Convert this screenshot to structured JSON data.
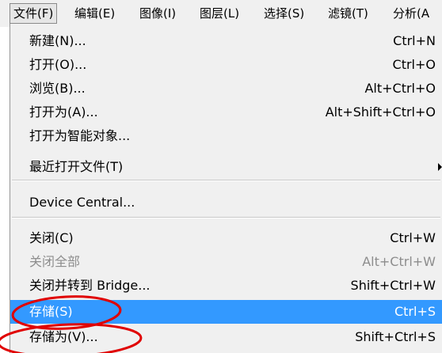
{
  "menubar": {
    "items": [
      {
        "label": "文件(F)"
      },
      {
        "label": "编辑(E)"
      },
      {
        "label": "图像(I)"
      },
      {
        "label": "图层(L)"
      },
      {
        "label": "选择(S)"
      },
      {
        "label": "滤镜(T)"
      },
      {
        "label": "分析(A"
      }
    ]
  },
  "file_menu": {
    "items": [
      {
        "label": "新建(N)...",
        "shortcut": "Ctrl+N",
        "enabled": true
      },
      {
        "label": "打开(O)...",
        "shortcut": "Ctrl+O",
        "enabled": true
      },
      {
        "label": "浏览(B)...",
        "shortcut": "Alt+Ctrl+O",
        "enabled": true
      },
      {
        "label": "打开为(A)...",
        "shortcut": "Alt+Shift+Ctrl+O",
        "enabled": true
      },
      {
        "label": "打开为智能对象...",
        "shortcut": "",
        "enabled": true
      },
      {
        "label": "最近打开文件(T)",
        "shortcut": "",
        "enabled": true,
        "submenu": true
      },
      {
        "label": "Device Central...",
        "shortcut": "",
        "enabled": true
      },
      {
        "label": "关闭(C)",
        "shortcut": "Ctrl+W",
        "enabled": true
      },
      {
        "label": "关闭全部",
        "shortcut": "Alt+Ctrl+W",
        "enabled": false
      },
      {
        "label": "关闭并转到 Bridge...",
        "shortcut": "Shift+Ctrl+W",
        "enabled": true
      },
      {
        "label": "存储(S)",
        "shortcut": "Ctrl+S",
        "enabled": true,
        "highlighted": true
      },
      {
        "label": "存储为(V)...",
        "shortcut": "Shift+Ctrl+S",
        "enabled": true
      }
    ]
  },
  "colors": {
    "highlight": "#3399ff",
    "annotation": "#e00000",
    "disabled_text": "#8d8d8d",
    "menu_bg": "#f0f0f0"
  },
  "icons": {
    "submenu": "submenu-arrow-icon"
  }
}
